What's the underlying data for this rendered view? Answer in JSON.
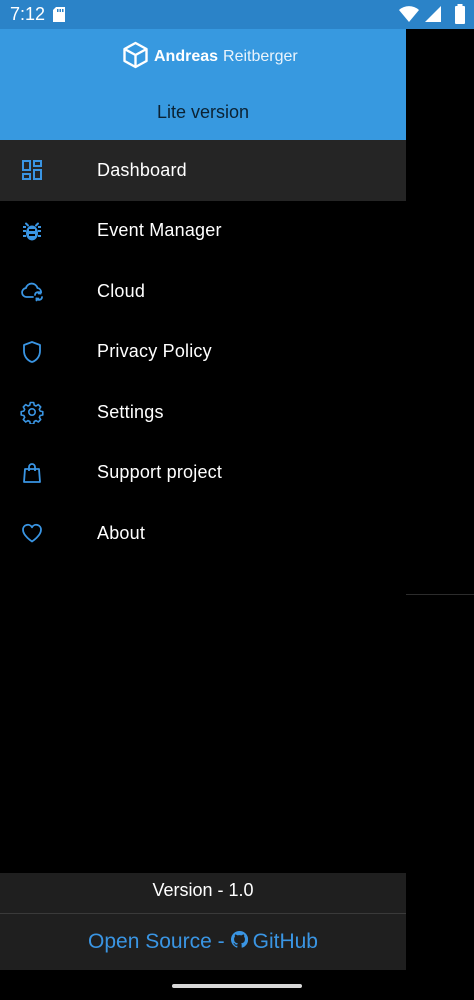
{
  "status_bar": {
    "time": "7:12",
    "bar_color": "#2b83c8"
  },
  "header": {
    "brand_bold": "Andreas",
    "brand_light": "Reitberger",
    "edition": "Lite version",
    "color": "#3799e0"
  },
  "menu": {
    "items": [
      {
        "label": "Dashboard",
        "icon": "dashboard-icon",
        "active": true
      },
      {
        "label": "Event Manager",
        "icon": "bug-icon"
      },
      {
        "label": "Cloud",
        "icon": "cloud-sync-icon"
      },
      {
        "label": "Privacy Policy",
        "icon": "shield-icon"
      },
      {
        "label": "Settings",
        "icon": "gear-icon"
      },
      {
        "label": "Support project",
        "icon": "shopping-bag-icon"
      },
      {
        "label": "About",
        "icon": "heart-icon"
      }
    ],
    "icon_color": "#3a95e3"
  },
  "footer": {
    "version": "Version - 1.0",
    "open_source": "Open Source -",
    "github": "GitHub",
    "link_color": "#3a95e3"
  }
}
